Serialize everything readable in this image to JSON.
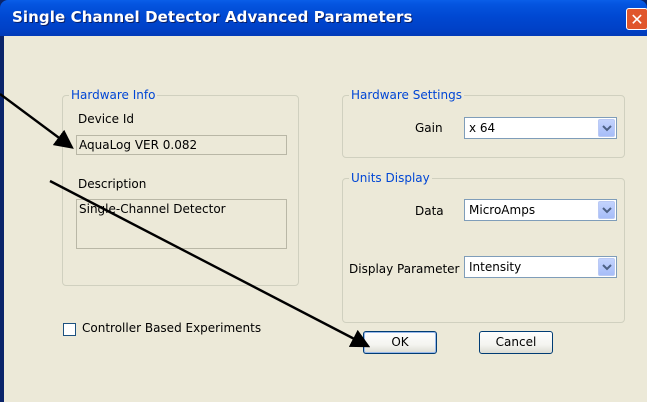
{
  "window": {
    "title": "Single Channel Detector Advanced Parameters",
    "close_glyph": "✕"
  },
  "hardware_info": {
    "legend": "Hardware Info",
    "device_id_label": "Device Id",
    "device_id_value": "AquaLog VER 0.082",
    "description_label": "Description",
    "description_value": "Single-Channel Detector"
  },
  "hardware_settings": {
    "legend": "Hardware Settings",
    "gain_label": "Gain",
    "gain_value": "x 64"
  },
  "units_display": {
    "legend": "Units Display",
    "data_label": "Data",
    "data_value": "MicroAmps",
    "display_parameter_label": "Display Parameter",
    "display_parameter_value": "Intensity"
  },
  "controller_based": {
    "label": "Controller Based Experiments",
    "checked": false
  },
  "buttons": {
    "ok": "OK",
    "cancel": "Cancel"
  },
  "colors": {
    "titlebar": "#0054e3",
    "dialog_bg": "#ece9d8",
    "group_legend": "#0046d5",
    "annotation_arrow": "#000000"
  }
}
